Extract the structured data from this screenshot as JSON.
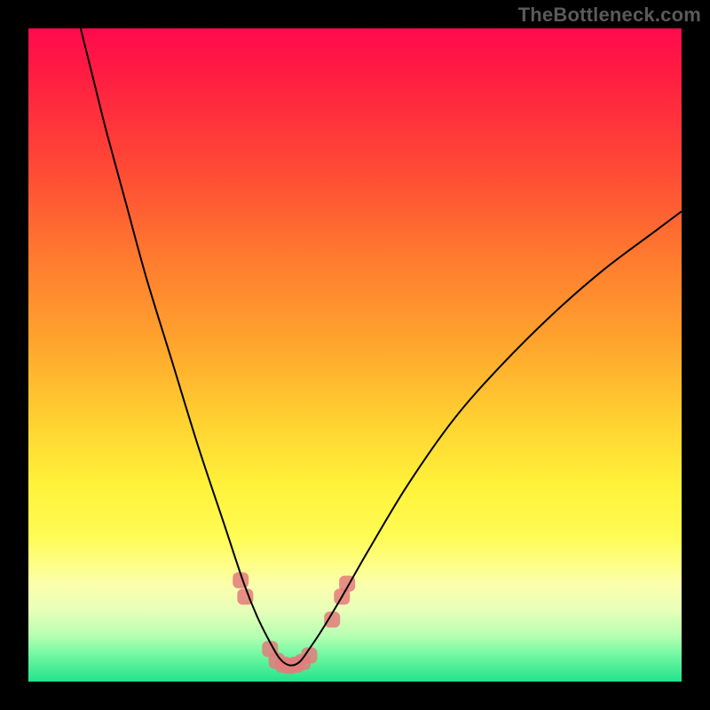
{
  "watermark": "TheBottleneck.com",
  "chart_data": {
    "type": "line",
    "title": "",
    "xlabel": "",
    "ylabel": "",
    "xlim": [
      0,
      100
    ],
    "ylim": [
      0,
      100
    ],
    "grid": false,
    "legend": false,
    "background_gradient_stops": [
      {
        "pos": 0.0,
        "color": "#ff0a4d"
      },
      {
        "pos": 0.08,
        "color": "#ff2040"
      },
      {
        "pos": 0.22,
        "color": "#ff4b35"
      },
      {
        "pos": 0.35,
        "color": "#ff7a2f"
      },
      {
        "pos": 0.48,
        "color": "#ffa42d"
      },
      {
        "pos": 0.6,
        "color": "#ffd131"
      },
      {
        "pos": 0.7,
        "color": "#fff23a"
      },
      {
        "pos": 0.78,
        "color": "#fffc55"
      },
      {
        "pos": 0.85,
        "color": "#fcffab"
      },
      {
        "pos": 0.89,
        "color": "#e8ffb8"
      },
      {
        "pos": 0.93,
        "color": "#b6ffb2"
      },
      {
        "pos": 0.96,
        "color": "#70f7a1"
      },
      {
        "pos": 1.0,
        "color": "#22e38c"
      }
    ],
    "series": [
      {
        "name": "bottleneck-curve",
        "color": "#000000",
        "stroke_width": 2,
        "x": [
          8,
          10,
          12,
          15,
          18,
          22,
          26,
          30,
          33,
          35,
          37,
          38.5,
          40,
          41.5,
          43,
          45,
          48,
          52,
          58,
          65,
          72,
          80,
          88,
          96,
          100
        ],
        "y": [
          100,
          92,
          84,
          73,
          62,
          49,
          36,
          24,
          15,
          10,
          6,
          3.5,
          2.5,
          3,
          5,
          8,
          13,
          20,
          30,
          40,
          48,
          56,
          63,
          69,
          72
        ]
      }
    ],
    "markers": {
      "name": "trough-markers",
      "color": "#e37b7b",
      "shape": "rounded-square",
      "size": 5,
      "x": [
        32.5,
        33.2,
        37.0,
        38.0,
        39.0,
        40.0,
        41.0,
        42.0,
        43.0,
        46.5,
        48.0,
        48.8
      ],
      "y": [
        15.5,
        13.0,
        5.0,
        3.2,
        2.6,
        2.4,
        2.6,
        3.0,
        4.0,
        9.5,
        13.0,
        15.0
      ]
    }
  }
}
